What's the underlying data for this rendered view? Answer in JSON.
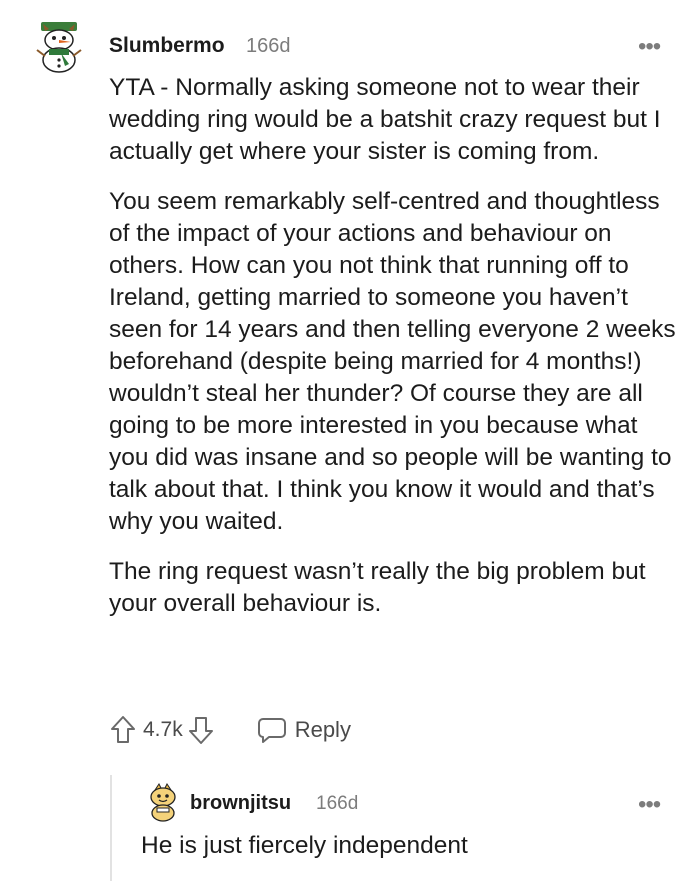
{
  "comment": {
    "username": "Slumbermo",
    "age": "166d",
    "more_label": "•••",
    "paragraphs": [
      "YTA - Normally asking someone not to wear their wedding ring would be a batshit crazy request but I actually get where your sister is coming from.",
      "You seem remarkably self-centred and thoughtless of the impact of your actions and behaviour on others. How can you not think that running off to Ireland, getting married to someone you haven’t seen for 14 years and then telling everyone 2 weeks beforehand (despite being married for 4 months!) wouldn’t steal her thunder? Of course they are all going to be more interested in you because what you did was insane and so people will be wanting to talk about that. I think you know it would and that’s why you waited.",
      "The ring request wasn’t really the big problem but your overall behaviour is."
    ],
    "score": "4.7k",
    "reply_label": "Reply",
    "avatar_icon": "snowman-avatar"
  },
  "reply": {
    "username": "brownjitsu",
    "age": "166d",
    "more_label": "•••",
    "text": "He is just fiercely independent",
    "avatar_icon": "snoo-avatar"
  }
}
